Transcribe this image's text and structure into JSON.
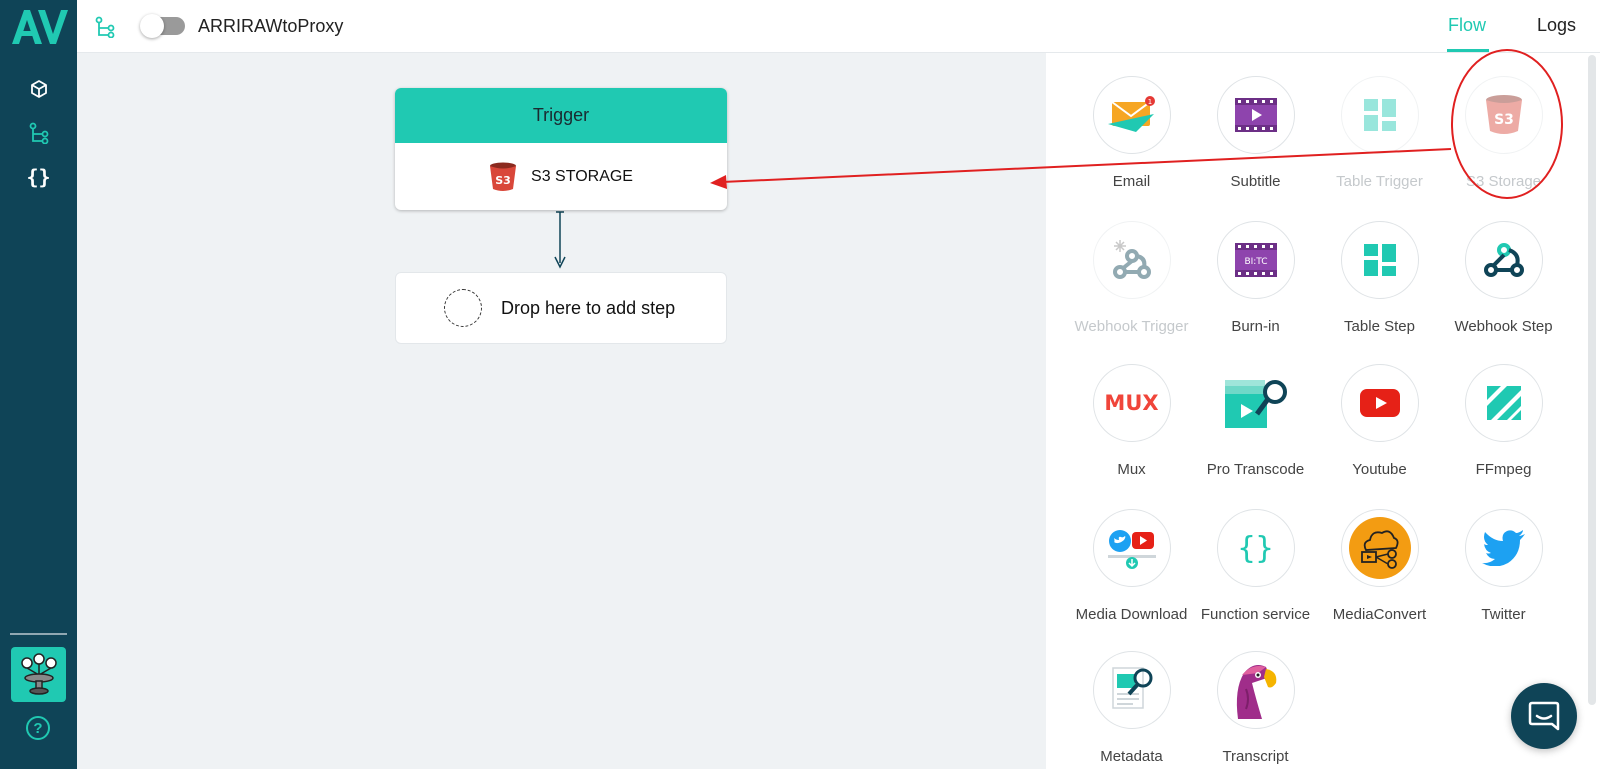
{
  "app": {
    "logo_text": "AV",
    "logo_color": "#20c9b2",
    "sidebar_color": "#0f4457",
    "accent_color": "#20c9b2"
  },
  "sidebar": {
    "items": [
      {
        "icon": "cube-icon",
        "active": false
      },
      {
        "icon": "flow-icon",
        "active": true
      },
      {
        "icon": "braces-icon",
        "label": "{}",
        "active": false
      }
    ],
    "help_label": "?"
  },
  "header": {
    "workflow_name": "ARRIRAWtoProxy",
    "toggle_on": false,
    "tabs": [
      {
        "label": "Flow",
        "active": true
      },
      {
        "label": "Logs",
        "active": false
      }
    ]
  },
  "canvas": {
    "trigger": {
      "title": "Trigger",
      "service_label": "S3 STORAGE",
      "service_icon": "s3-bucket-icon"
    },
    "drop_zone": {
      "label": "Drop here to add step"
    }
  },
  "palette": {
    "items": [
      {
        "label": "Email",
        "icon": "email-icon",
        "disabled": false
      },
      {
        "label": "Subtitle",
        "icon": "subtitle-icon",
        "disabled": false
      },
      {
        "label": "Table Trigger",
        "icon": "table-trigger-icon",
        "disabled": true
      },
      {
        "label": "S3 Storage",
        "icon": "s3-storage-icon",
        "disabled": true
      },
      {
        "label": "Webhook Trigger",
        "icon": "webhook-trigger-icon",
        "disabled": true
      },
      {
        "label": "Burn-in",
        "icon": "burn-in-icon",
        "badge": "BI:TC",
        "disabled": false
      },
      {
        "label": "Table Step",
        "icon": "table-step-icon",
        "disabled": false
      },
      {
        "label": "Webhook Step",
        "icon": "webhook-step-icon",
        "disabled": false
      },
      {
        "label": "Mux",
        "icon": "mux-icon",
        "badge": "MUX",
        "disabled": false
      },
      {
        "label": "Pro Transcode",
        "icon": "pro-transcode-icon",
        "disabled": false
      },
      {
        "label": "Youtube",
        "icon": "youtube-icon",
        "disabled": false
      },
      {
        "label": "FFmpeg",
        "icon": "ffmpeg-icon",
        "disabled": false
      },
      {
        "label": "Media Download",
        "icon": "media-download-icon",
        "disabled": false
      },
      {
        "label": "Function service",
        "icon": "function-service-icon",
        "badge": "{}",
        "disabled": false
      },
      {
        "label": "MediaConvert",
        "icon": "mediaconvert-icon",
        "disabled": false
      },
      {
        "label": "Twitter",
        "icon": "twitter-icon",
        "disabled": false
      },
      {
        "label": "Metadata",
        "icon": "metadata-icon",
        "disabled": false
      },
      {
        "label": "Transcript",
        "icon": "transcript-icon",
        "disabled": false
      }
    ]
  },
  "annotation": {
    "color": "#e02020",
    "highlight": "S3 Storage",
    "target": "S3 STORAGE"
  }
}
